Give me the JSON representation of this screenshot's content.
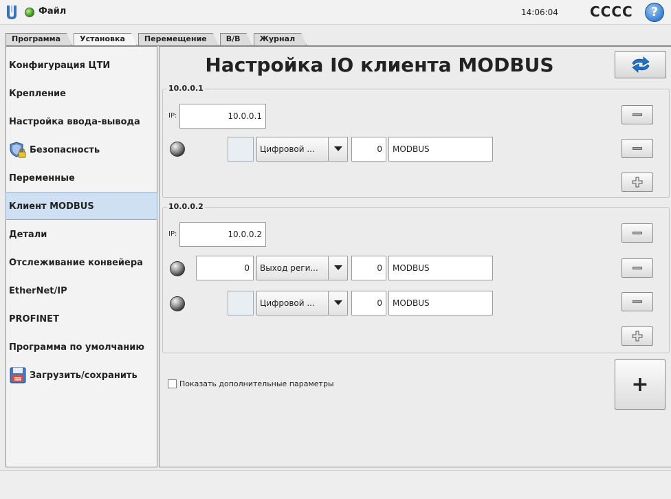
{
  "topbar": {
    "file_menu": "Файл",
    "clock": "14:06:04",
    "robot_name": "CCCC",
    "help": "?",
    "logo_icon": "ur-logo-icon",
    "status_icon": "status-green-icon"
  },
  "tabs": [
    {
      "label": "Программа",
      "active": false
    },
    {
      "label": "Установка",
      "active": true
    },
    {
      "label": "Перемещение",
      "active": false
    },
    {
      "label": "В/В",
      "active": false
    },
    {
      "label": "Журнал",
      "active": false
    }
  ],
  "sidebar": {
    "items": [
      {
        "label": "Конфигурация ЦТИ"
      },
      {
        "label": "Крепление"
      },
      {
        "label": "Настройка ввода-вывода"
      },
      {
        "label": "Безопасность",
        "icon": "shield-lock-icon"
      },
      {
        "label": "Переменные"
      },
      {
        "label": "Клиент MODBUS",
        "active": true
      },
      {
        "label": "Детали"
      },
      {
        "label": "Отслеживание конвейера"
      },
      {
        "label": "EtherNet/IP"
      },
      {
        "label": "PROFINET"
      },
      {
        "label": "Программа по умолчанию"
      },
      {
        "label": "Загрузить/сохранить",
        "icon": "floppy-disk-icon"
      }
    ]
  },
  "main": {
    "title": "Настройка IO клиента MODBUS",
    "refresh_icon": "refresh-arrows-icon",
    "ip_prefix": "IP:",
    "units": [
      {
        "title": "10.0.0.1",
        "ip": "10.0.0.1",
        "signals": [
          {
            "register": "",
            "type": "Цифровой ...",
            "address": "0",
            "name": "MODBUS"
          }
        ]
      },
      {
        "title": "10.0.0.2",
        "ip": "10.0.0.2",
        "signals": [
          {
            "register": "0",
            "type": "Выход реги...",
            "address": "0",
            "name": "MODBUS"
          },
          {
            "register": "",
            "type": "Цифровой ...",
            "address": "0",
            "name": "MODBUS"
          }
        ]
      }
    ],
    "advanced_checkbox": {
      "label": "Показать дополнительные параметры",
      "checked": false
    },
    "add_unit_label": "+"
  },
  "colors": {
    "active_item_bg": "#cfe0f2",
    "refresh_arrow": "#1e73c8"
  }
}
